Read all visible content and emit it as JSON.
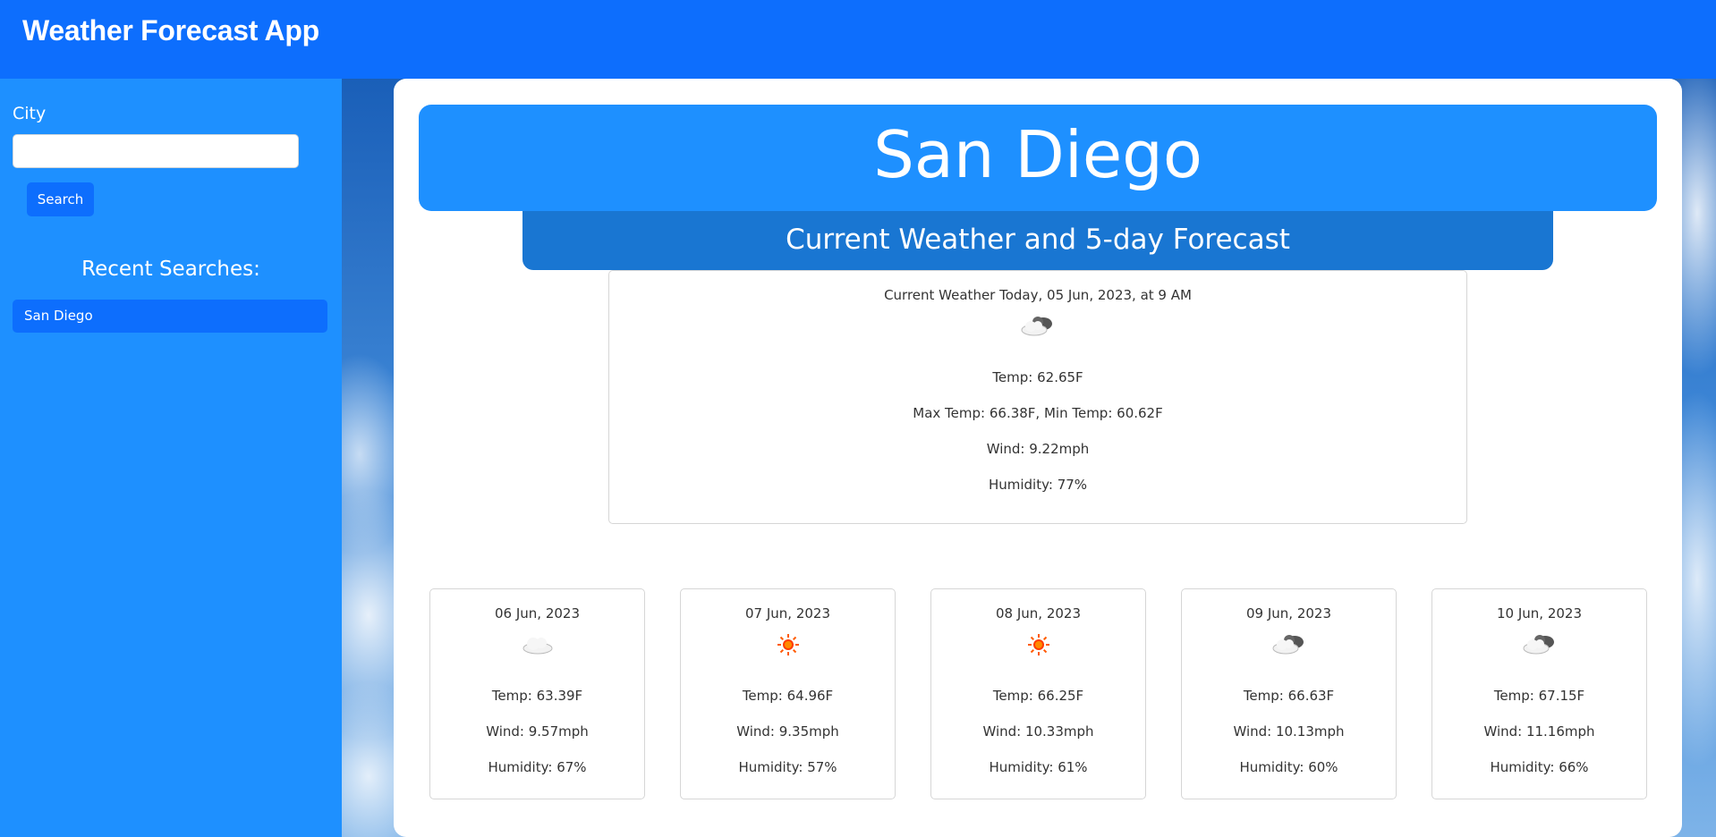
{
  "header": {
    "title": "Weather Forecast App"
  },
  "sidebar": {
    "city_label": "City",
    "city_input_value": "",
    "search_label": "Search",
    "recent_heading": "Recent Searches:",
    "recent": [
      "San Diego"
    ]
  },
  "main": {
    "city": "San Diego",
    "subtitle": "Current Weather and 5-day Forecast",
    "current": {
      "heading": "Current Weather Today, 05 Jun, 2023, at 9 AM",
      "icon": "partly-cloudy-icon",
      "temp": "Temp: 62.65F",
      "minmax": "Max Temp: 66.38F, Min Temp: 60.62F",
      "wind": "Wind: 9.22mph",
      "humidity": "Humidity: 77%"
    },
    "forecast": [
      {
        "date": "06 Jun, 2023",
        "icon": "cloud-icon",
        "temp": "Temp: 63.39F",
        "wind": "Wind: 9.57mph",
        "humidity": "Humidity: 67%"
      },
      {
        "date": "07 Jun, 2023",
        "icon": "sun-icon",
        "temp": "Temp: 64.96F",
        "wind": "Wind: 9.35mph",
        "humidity": "Humidity: 57%"
      },
      {
        "date": "08 Jun, 2023",
        "icon": "sun-icon",
        "temp": "Temp: 66.25F",
        "wind": "Wind: 10.33mph",
        "humidity": "Humidity: 61%"
      },
      {
        "date": "09 Jun, 2023",
        "icon": "partly-cloudy-icon",
        "temp": "Temp: 66.63F",
        "wind": "Wind: 10.13mph",
        "humidity": "Humidity: 60%"
      },
      {
        "date": "10 Jun, 2023",
        "icon": "partly-cloudy-icon",
        "temp": "Temp: 67.15F",
        "wind": "Wind: 11.16mph",
        "humidity": "Humidity: 66%"
      }
    ]
  },
  "colors": {
    "header_bg": "#0d6efd",
    "sidebar_bg": "#1e90ff",
    "banner_bg": "#1e90ff",
    "sub_banner_bg": "#1976d2",
    "button_bg": "#0d6efd"
  }
}
